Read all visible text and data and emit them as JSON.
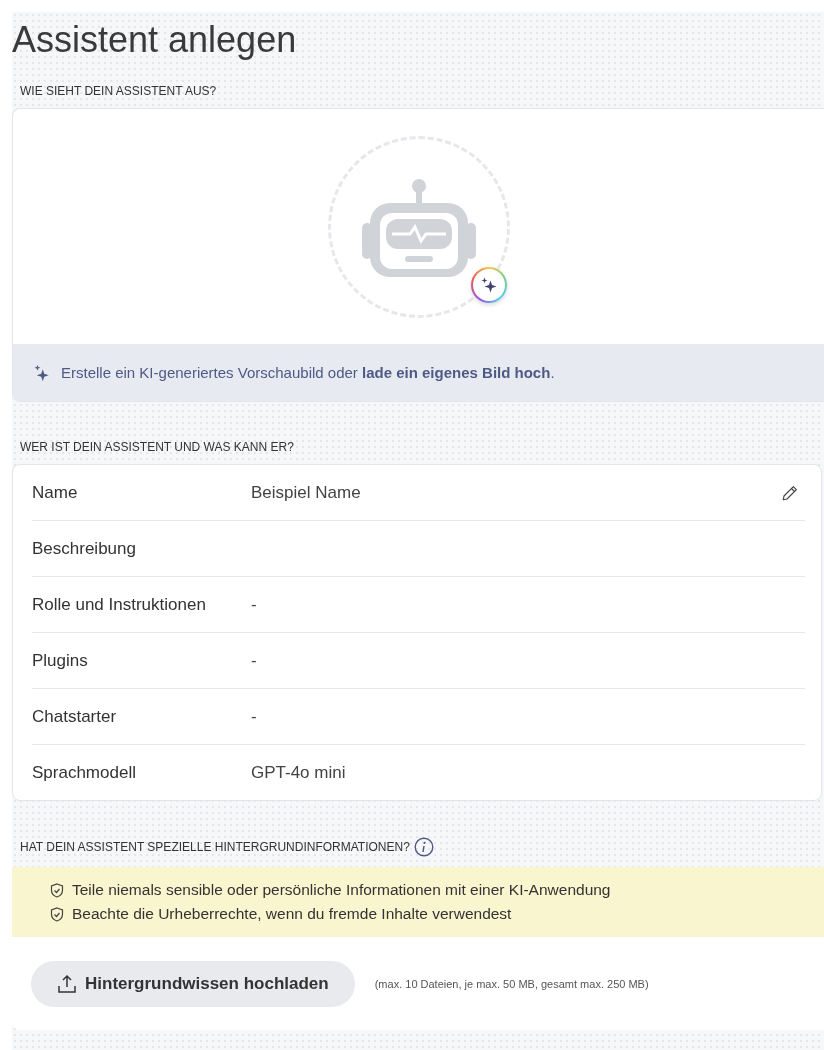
{
  "title": "Assistent anlegen",
  "appearance": {
    "label": "WIE SIEHT DEIN ASSISTENT AUS?",
    "hint": "Erstelle ein KI-generiertes Vorschaubild oder **lade ein eigenes Bild hoch**."
  },
  "details": {
    "label": "WER IST DEIN ASSISTENT UND WAS KANN ER?",
    "rows": [
      {
        "label": "Name",
        "value": "Beispiel Name",
        "editable": true
      },
      {
        "label": "Beschreibung",
        "editable": false
      },
      {
        "label": "Rolle und Instruktionen",
        "value": "-",
        "editable": false
      },
      {
        "label": "Plugins",
        "value": "-",
        "editable": false
      },
      {
        "label": "Chatstarter",
        "value": "-",
        "editable": false
      },
      {
        "label": "Sprachmodell",
        "value": "GPT-4o mini",
        "editable": false
      }
    ]
  },
  "background": {
    "label": "HAT DEIN ASSISTENT SPEZIELLE HINTERGRUNDINFORMATIONEN?",
    "warnings": [
      "Teile niemals sensible oder persönliche Informationen mit einer KI-Anwendung",
      "Beachte die Urheberrechte, wenn du fremde Inhalte verwendest"
    ],
    "upload_button": "Hintergrundwissen hochladen",
    "limits": "(max. 10 Dateien, je max. 50 MB, gesamt max. 250 MB)"
  }
}
